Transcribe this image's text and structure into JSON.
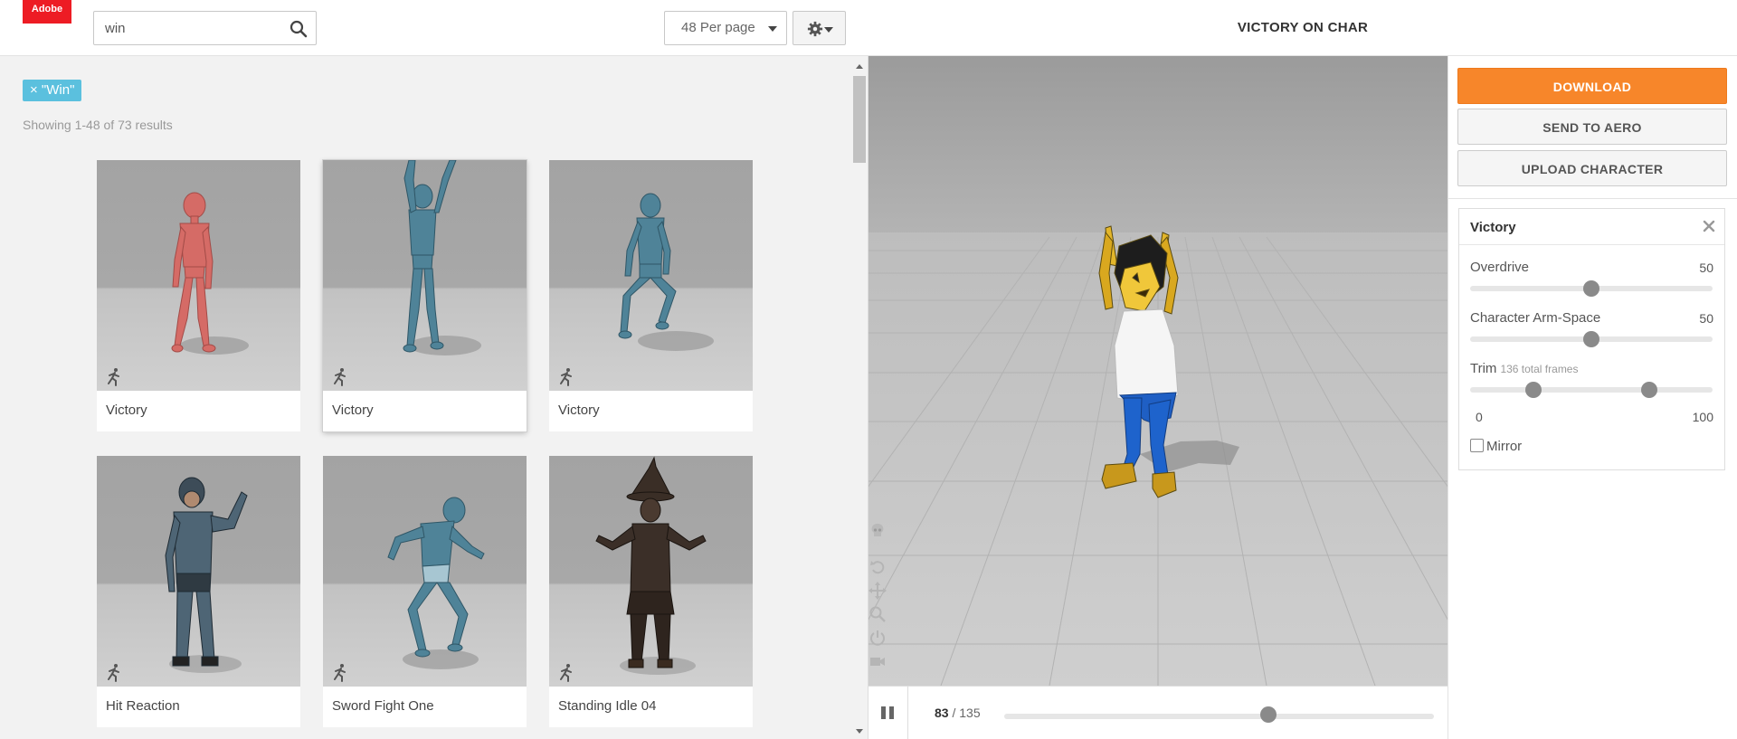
{
  "header": {
    "logo_text": "Adobe",
    "search_value": "win",
    "per_page_selected": "48 Per page"
  },
  "filter": {
    "tag_label": "× \"Win\"",
    "results_text": "Showing 1-48 of 73 results"
  },
  "cards": [
    {
      "label": "Victory",
      "selected": false
    },
    {
      "label": "Victory",
      "selected": true
    },
    {
      "label": "Victory",
      "selected": false
    },
    {
      "label": "Hit Reaction",
      "selected": false
    },
    {
      "label": "Sword Fight One",
      "selected": false
    },
    {
      "label": "Standing Idle 04",
      "selected": false
    }
  ],
  "viewer": {
    "title": "VICTORY ON CHAR",
    "current_frame": "83",
    "frame_separator": "/ 135",
    "total_frames": 135,
    "playhead_fraction": 0.615
  },
  "panel": {
    "download_label": "DOWNLOAD",
    "aero_label": "SEND TO AERO",
    "upload_label": "UPLOAD CHARACTER",
    "settings_title": "Victory",
    "overdrive_label": "Overdrive",
    "overdrive_value": "50",
    "armspace_label": "Character Arm-Space",
    "armspace_value": "50",
    "trim_label": "Trim",
    "trim_note": "136 total frames",
    "trim_min": "0",
    "trim_max": "100",
    "trim_start_fraction": 0.26,
    "trim_end_fraction": 0.74,
    "mirror_label": "Mirror",
    "mirror_checked": false
  },
  "colors": {
    "accent_orange": "#f7862a",
    "tag_blue": "#5bc0de",
    "logo_red": "#ed1c24",
    "mannequin_red": "#d86a66",
    "mannequin_blue": "#4e8196"
  },
  "icons": [
    "search-icon",
    "gear-icon",
    "run-icon",
    "pause-icon",
    "close-icon",
    "skull-icon",
    "undo-icon",
    "move-icon",
    "zoom-icon",
    "power-icon",
    "camera-icon"
  ]
}
